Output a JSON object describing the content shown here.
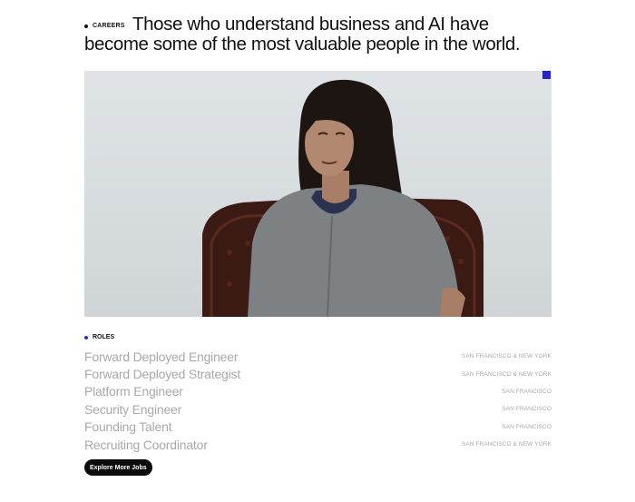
{
  "careers": {
    "label": "CAREERS"
  },
  "headline": {
    "text": "Those who understand business and AI have become some of the most valuable people in the world."
  },
  "roles": {
    "label": "ROLES",
    "items": [
      {
        "title": "Forward Deployed Engineer",
        "location": "SAN FRANCISCO & NEW YORK"
      },
      {
        "title": "Forward Deployed Strategist",
        "location": "SAN FRANCISCO & NEW YORK"
      },
      {
        "title": "Platform Engineer",
        "location": "SAN FRANCISCO"
      },
      {
        "title": "Security Engineer",
        "location": "SAN FRANCISCO"
      },
      {
        "title": "Founding Talent",
        "location": "SAN FRANCISCO"
      },
      {
        "title": "Recruiting Coordinator",
        "location": "SAN FRANCISCO & NEW YORK"
      }
    ]
  },
  "explore_button": {
    "label": "Explore More Jobs"
  },
  "colors": {
    "accent": "#2424c8",
    "button_bg": "#0b0b0b",
    "muted_text": "#a9a9a9"
  }
}
